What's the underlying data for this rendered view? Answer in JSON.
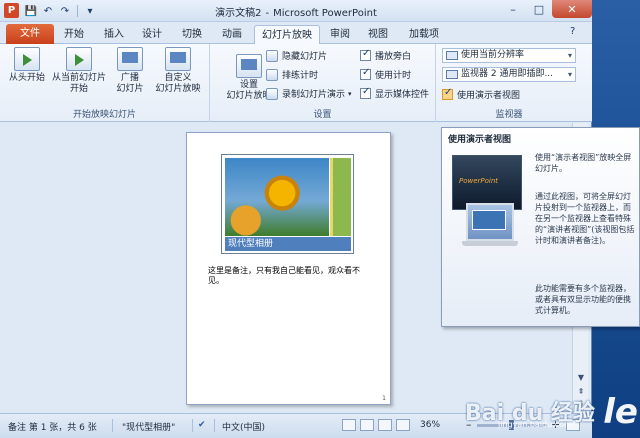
{
  "window": {
    "app_icon": "P",
    "doc_name": "演示文稿2",
    "separator": "-",
    "app_name": "Microsoft PowerPoint",
    "buttons": {
      "minimize": "–",
      "maximize": "□",
      "close": "✕"
    }
  },
  "quick_access": {
    "save_icon": "💾",
    "undo_icon": "↶",
    "redo_icon": "↷",
    "customize_icon": "▾"
  },
  "tabs": {
    "file": "文件",
    "items": [
      "开始",
      "插入",
      "设计",
      "切换",
      "动画",
      "幻灯片放映",
      "审阅",
      "视图",
      "加载项"
    ],
    "active_index": 5,
    "help_icon": "?"
  },
  "ribbon": {
    "group_start": {
      "label": "开始放映幻灯片",
      "from_beginning": "从头开始",
      "from_current_1": "从当前幻灯片",
      "from_current_2": "开始",
      "broadcast_1": "广播",
      "broadcast_2": "幻灯片",
      "custom_1": "自定义",
      "custom_2": "幻灯片放映"
    },
    "group_setup": {
      "label": "设置",
      "setup_1": "设置",
      "setup_2": "幻灯片放映",
      "hide_slide": "隐藏幻灯片",
      "rehearse": "排练计时",
      "record": "录制幻灯片演示",
      "play_narration": "播放旁白",
      "use_timings": "使用计时",
      "show_media": "显示媒体控件"
    },
    "group_monitors": {
      "label": "监视器",
      "resolution": "使用当前分辨率",
      "monitor": "监视器 2  通用即插即...",
      "presenter_view": "使用演示者视图"
    }
  },
  "slide": {
    "caption": "现代型相册",
    "notes": "这里是备注，只有我自己能看见，观众看不见。",
    "page_number": "1"
  },
  "tooltip": {
    "title": "使用演示者视图",
    "image_title": "PowerPoint",
    "p1": "使用“演示者视图”放映全屏幻灯片。",
    "p2": "通过此视图，可将全屏幻灯片投射到一个监视器上，而在另一个监视器上查看特殊的“演讲者视图”(该视图包括计时和演讲者备注)。",
    "p3": "此功能需要有多个监视器，或者具有双显示功能的便携式计算机。"
  },
  "statusbar": {
    "page_info": "备注 第 1 张，共 6 张",
    "theme": "\"现代型相册\"",
    "language": "中文(中国)",
    "zoom": "36%",
    "zoom_minus": "–",
    "zoom_plus": "+"
  },
  "watermark": {
    "text": "Bai du 经验",
    "url": "jingyan.baidu.com"
  },
  "desktop": {
    "logo": "le"
  }
}
